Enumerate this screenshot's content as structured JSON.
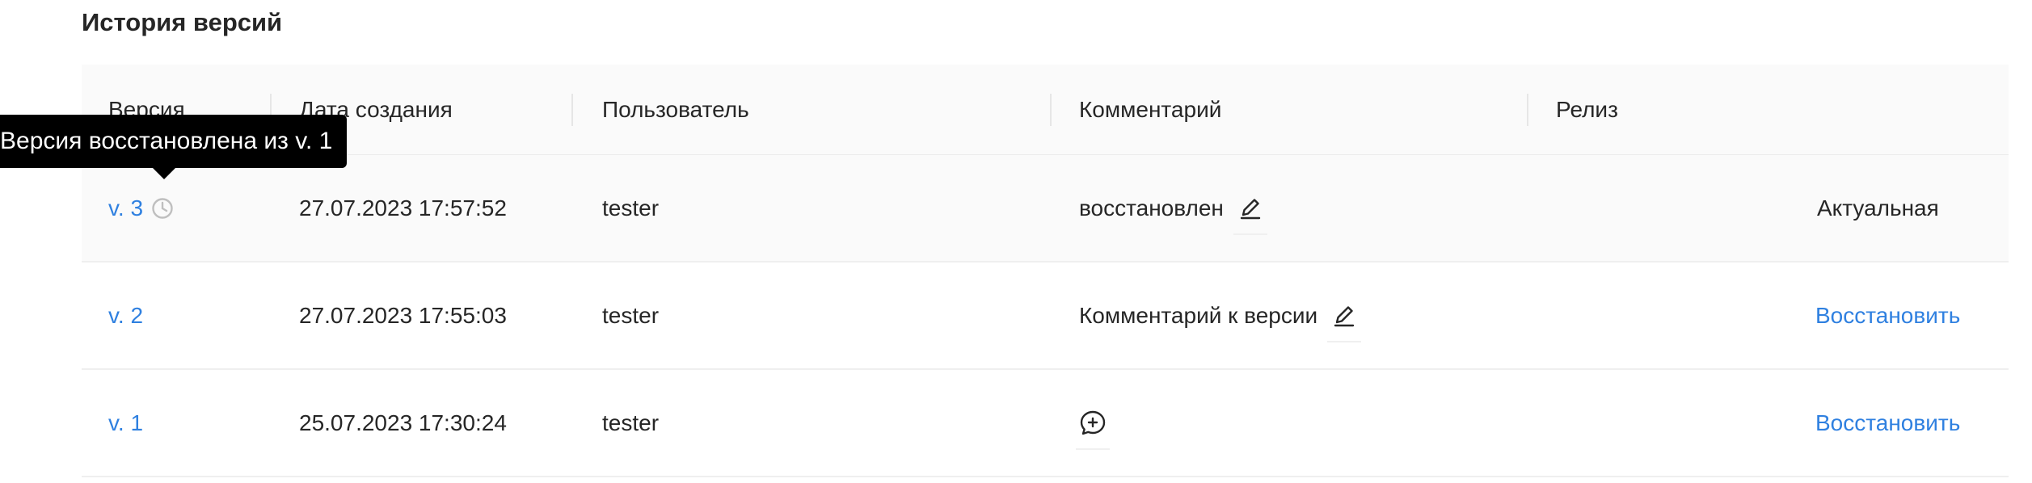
{
  "page": {
    "title": "История версий"
  },
  "table": {
    "columns": [
      "Версия",
      "Дата создания",
      "Пользователь",
      "Комментарий",
      "Релиз"
    ],
    "rows": [
      {
        "version": "v. 3",
        "date": "27.07.2023 17:57:52",
        "user": "tester",
        "comment": "восстановлен",
        "release": "Актуальная",
        "restored": true
      },
      {
        "version": "v. 2",
        "date": "27.07.2023 17:55:03",
        "user": "tester",
        "comment": "Комментарий к версии",
        "release": "Восстановить"
      },
      {
        "version": "v. 1",
        "date": "25.07.2023 17:30:24",
        "user": "tester",
        "comment": "",
        "release": "Восстановить"
      }
    ]
  },
  "tooltip": {
    "text": "Версия восстановлена из v. 1"
  },
  "icons": {
    "restored": "history-icon",
    "edit": "pencil-icon",
    "add_comment": "add-comment-icon"
  },
  "colors": {
    "link": "#2f80e0",
    "tooltip_bg": "#000000",
    "header_bg": "#fafafa"
  }
}
